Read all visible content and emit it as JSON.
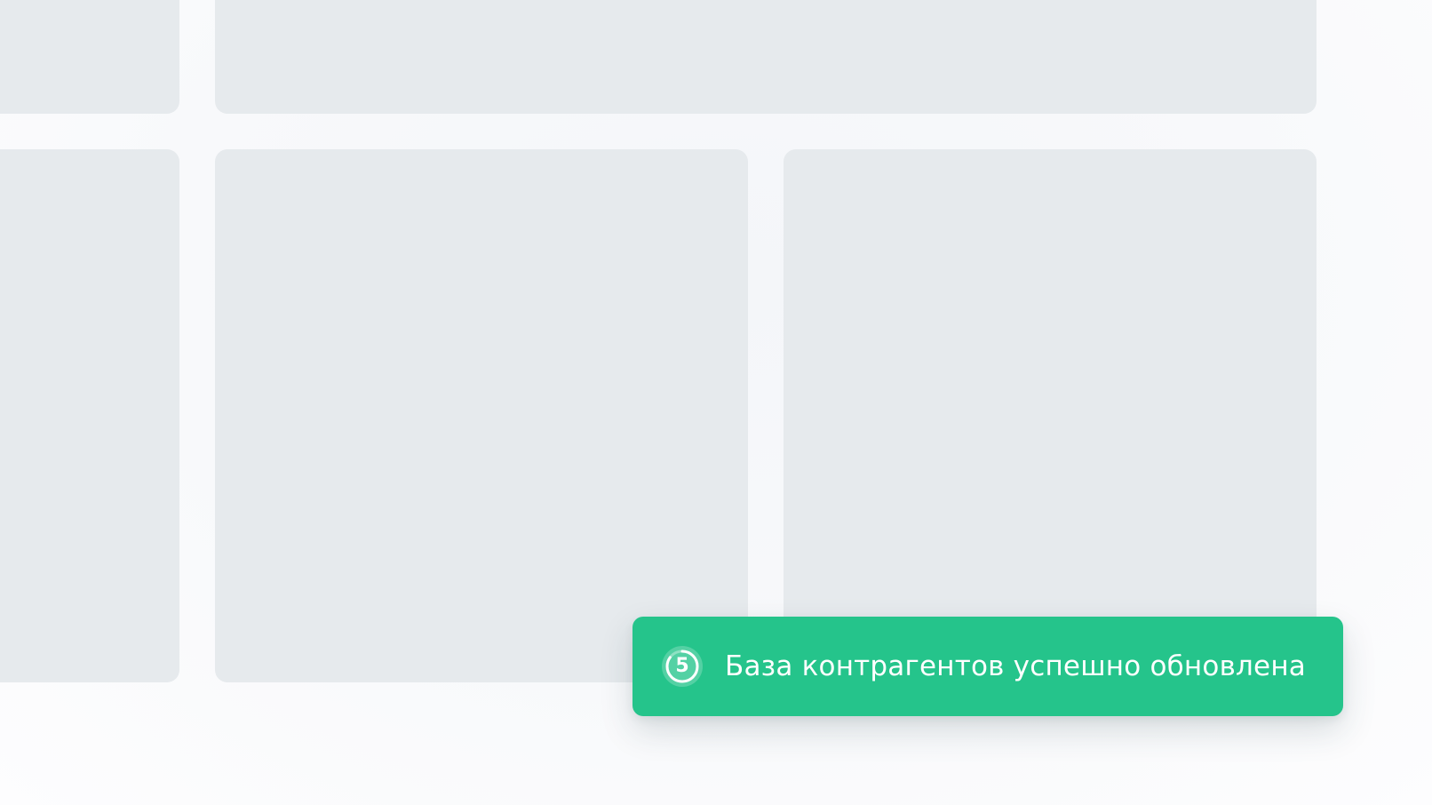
{
  "toast": {
    "message": "База контрагентов успешно обновлена",
    "countdown": "5",
    "countdown_progress": 0.85,
    "background_color": "#25c48b",
    "icon": "countdown-timer-icon"
  },
  "skeleton": {
    "card_color": "#e6eaed",
    "page_background": "#fafbfc"
  }
}
